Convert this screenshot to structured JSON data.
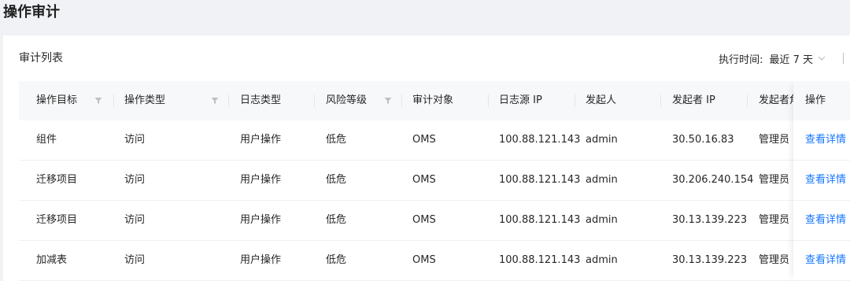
{
  "page": {
    "title": "操作审计"
  },
  "panel": {
    "title": "审计列表",
    "filter": {
      "label": "执行时间:",
      "value": "最近 7 天"
    }
  },
  "table": {
    "columns": [
      "操作目标",
      "操作类型",
      "日志类型",
      "风险等级",
      "审计对象",
      "日志源 IP",
      "发起人",
      "发起者 IP",
      "发起者角色",
      "操作"
    ],
    "rows": [
      [
        "组件",
        "访问",
        "用户操作",
        "低危",
        "OMS",
        "100.88.121.143",
        "admin",
        "30.50.16.83",
        "管理员",
        "查看详情"
      ],
      [
        "迁移项目",
        "访问",
        "用户操作",
        "低危",
        "OMS",
        "100.88.121.143",
        "admin",
        "30.206.240.154",
        "管理员",
        "查看详情"
      ],
      [
        "迁移项目",
        "访问",
        "用户操作",
        "低危",
        "OMS",
        "100.88.121.143",
        "admin",
        "30.13.139.223",
        "管理员",
        "查看详情"
      ],
      [
        "加减表",
        "访问",
        "用户操作",
        "低危",
        "OMS",
        "100.88.121.143",
        "admin",
        "30.13.139.223",
        "管理员",
        "查看详情"
      ]
    ]
  },
  "icons": {
    "filter": "filter-icon",
    "dropdown": "chevron-down-icon"
  },
  "colors": {
    "link": "#1677ff",
    "header_bg": "#f7f8fa",
    "page_bg": "#f0f2f5"
  }
}
